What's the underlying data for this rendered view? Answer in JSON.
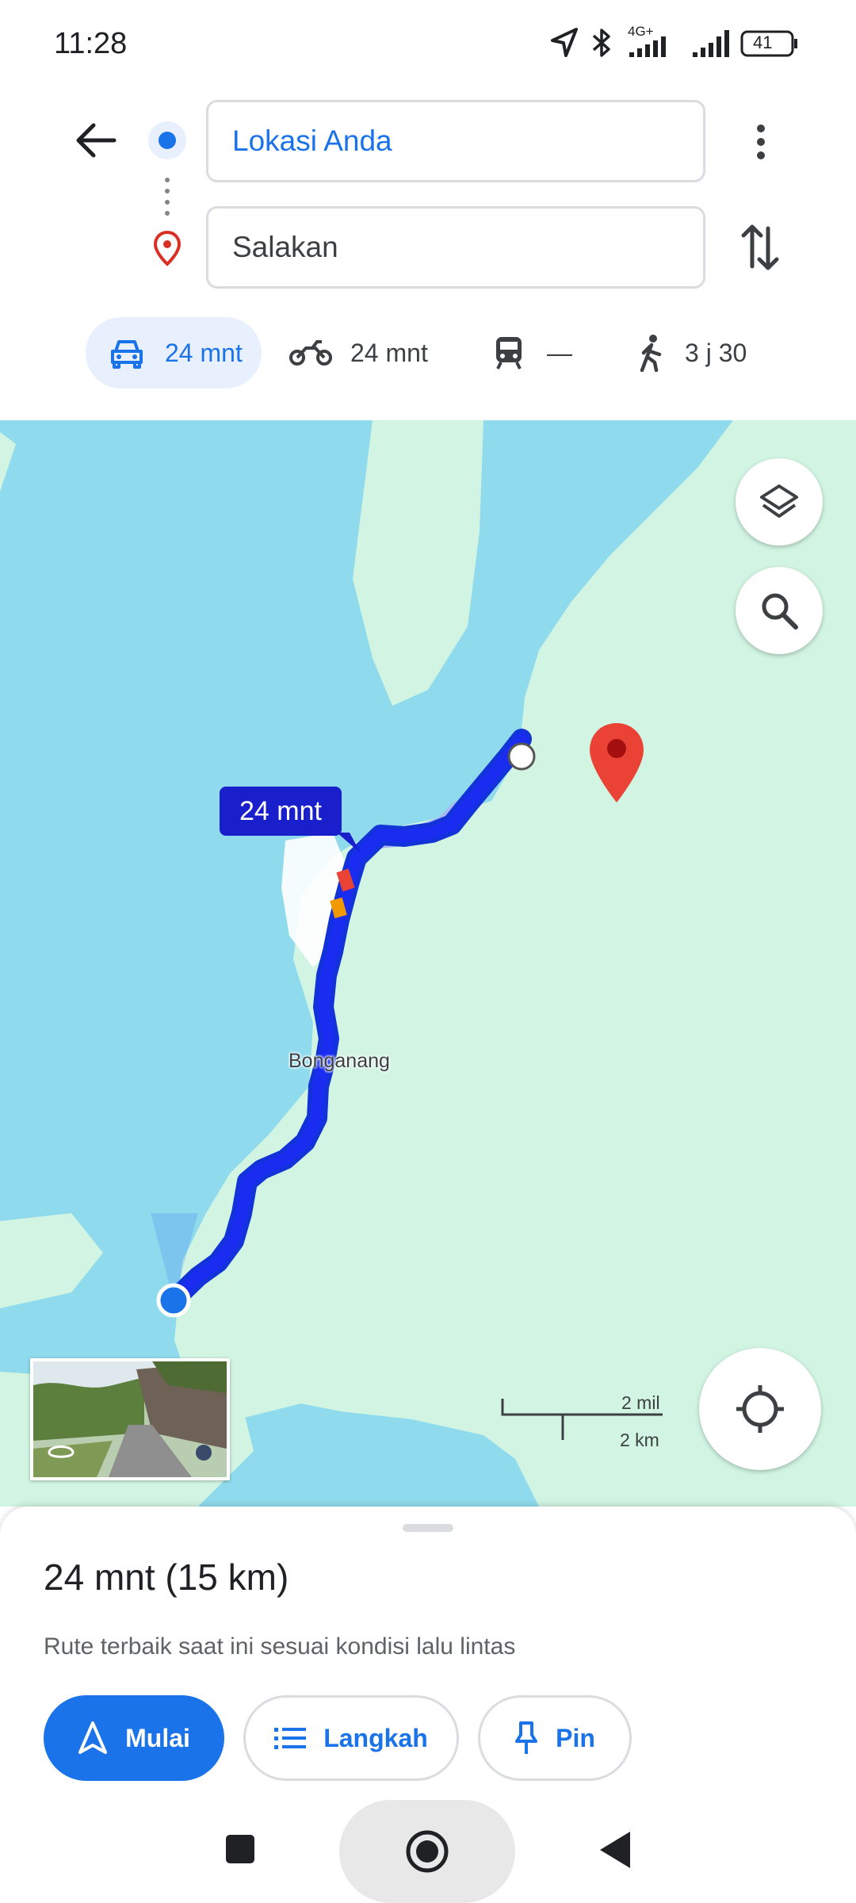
{
  "status_bar": {
    "time": "11:28",
    "network_label": "4G+",
    "battery": "41",
    "icons": [
      "location-arrow-icon",
      "bluetooth-icon",
      "signal-4g-icon",
      "signal-icon",
      "battery-icon"
    ]
  },
  "directions": {
    "origin": "Lokasi Anda",
    "destination": "Salakan",
    "modes": [
      {
        "icon": "car-icon",
        "label": "24 mnt",
        "selected": true
      },
      {
        "icon": "motorcycle-icon",
        "label": "24 mnt",
        "selected": false
      },
      {
        "icon": "transit-icon",
        "label": "—",
        "selected": false
      },
      {
        "icon": "walk-icon",
        "label": "3 j 30",
        "selected": false
      }
    ]
  },
  "map": {
    "eta_bubble": "24 mnt",
    "place_label": "Bonganang",
    "scale_imperial": "2 mil",
    "scale_metric": "2 km",
    "colors": {
      "water": "#8fdbed",
      "land": "#d2f5e3",
      "route": "#1a2cf0",
      "route_alt": "#a9b8f0",
      "pin": "#ea4335"
    }
  },
  "sheet": {
    "title": "24 mnt (15 km)",
    "subtitle": "Rute terbaik saat ini sesuai kondisi lalu lintas",
    "buttons": {
      "start": "Mulai",
      "steps": "Langkah",
      "pin": "Pin"
    }
  }
}
